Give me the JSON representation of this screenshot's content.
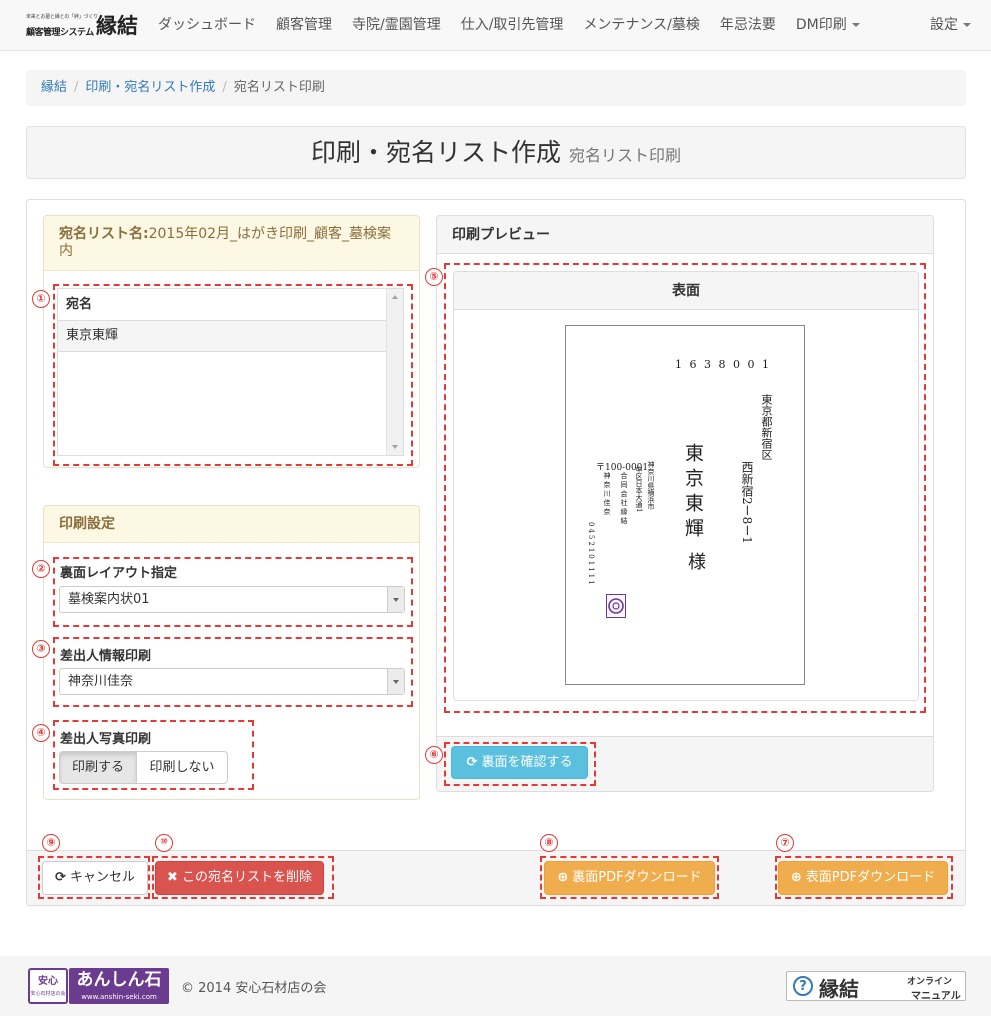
{
  "brand": {
    "tagline": "未来とお墓と縁との「絆」づくり",
    "system": "顧客管理システム",
    "logo": "縁結"
  },
  "nav": {
    "items": [
      "ダッシュボード",
      "顧客管理",
      "寺院/霊園管理",
      "仕入/取引先管理",
      "メンテナンス/墓検",
      "年忌法要"
    ],
    "dm_print": "DM印刷",
    "settings": "設定"
  },
  "breadcrumb": {
    "home": "縁結",
    "parent": "印刷・宛名リスト作成",
    "current": "宛名リスト印刷"
  },
  "page": {
    "title": "印刷・宛名リスト作成",
    "subtitle": "宛名リスト印刷"
  },
  "list_panel": {
    "label": "宛名リスト名:",
    "name": "2015年02月_はがき印刷_顧客_墓検案内",
    "column": "宛名",
    "rows": [
      "東京東輝"
    ]
  },
  "print_settings": {
    "heading": "印刷設定",
    "layout_label": "裏面レイアウト指定",
    "layout_value": "墓検案内状01",
    "sender_label": "差出人情報印刷",
    "sender_value": "神奈川佳奈",
    "photo_label": "差出人写真印刷",
    "photo_on": "印刷する",
    "photo_off": "印刷しない"
  },
  "preview": {
    "heading": "印刷プレビュー",
    "side": "表面",
    "postal_code": "1 6 3 8 0 0 1",
    "address_1": "東京都新宿区",
    "address_2": "西新宿2ー8ー1",
    "recipient": "東京東輝",
    "honorific": "様",
    "sender_postal": "〒100-0001",
    "sender_addr_1": "神奈川県横浜市",
    "sender_addr_2": "中区日本大通1",
    "sender_company": "合同会社縁結",
    "sender_name": "神奈川佳奈",
    "sender_phone": "0452101111",
    "confirm_button": "裏面を確認する"
  },
  "actions": {
    "cancel": "キャンセル",
    "delete": "この宛名リストを削除",
    "back_pdf": "裏面PDFダウンロード",
    "front_pdf": "表面PDFダウンロード"
  },
  "markers": [
    "①",
    "②",
    "③",
    "④",
    "⑤",
    "⑥",
    "⑦",
    "⑧",
    "⑨",
    "⑩"
  ],
  "footer": {
    "badge_top": "安心",
    "badge_bottom": "安心石材店の会",
    "brand": "あんしん石",
    "url": "www.anshin-seki.com",
    "copyright": "© 2014 安心石材店の会",
    "manual_logo": "縁結",
    "manual_line1": "オンライン",
    "manual_line2": "マニュアル"
  },
  "colors": {
    "link": "#337ab7",
    "annotation": "#e53935",
    "danger": "#d9534f",
    "warning": "#f0ad4e",
    "info": "#5bc0de"
  }
}
